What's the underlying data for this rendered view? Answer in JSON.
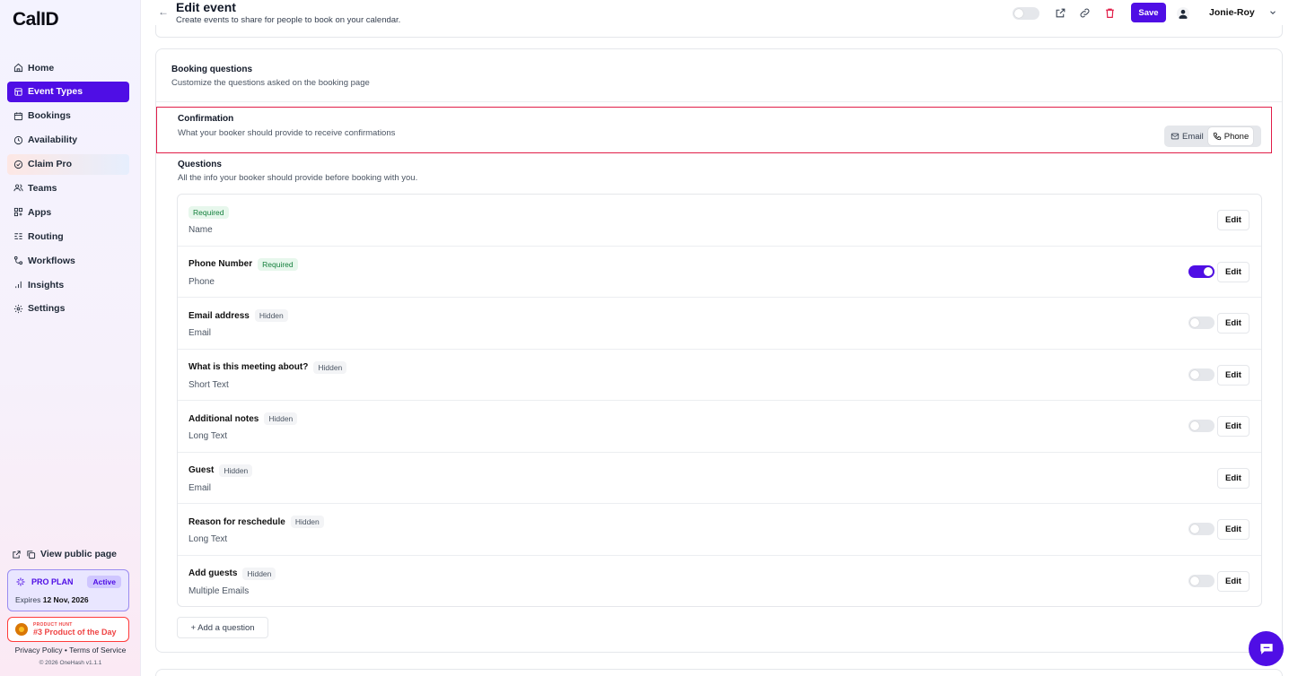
{
  "brand": {
    "logo": "CalID",
    "accent": "#4f0ee5"
  },
  "sidebar": {
    "items": [
      {
        "label": "Home",
        "icon": "home-icon"
      },
      {
        "label": "Event Types",
        "icon": "link-icon",
        "active": true
      },
      {
        "label": "Bookings",
        "icon": "calendar-icon"
      },
      {
        "label": "Availability",
        "icon": "clock-icon"
      },
      {
        "label": "Claim Pro",
        "icon": "badge-icon"
      },
      {
        "label": "Teams",
        "icon": "users-icon"
      },
      {
        "label": "Apps",
        "icon": "grid-icon"
      },
      {
        "label": "Routing",
        "icon": "routing-icon"
      },
      {
        "label": "Workflows",
        "icon": "workflow-icon"
      },
      {
        "label": "Insights",
        "icon": "bar-chart-icon"
      },
      {
        "label": "Settings",
        "icon": "gear-icon"
      }
    ],
    "public_page": "View public page",
    "plan": {
      "name": "PRO PLAN",
      "status": "Active",
      "expires_label": "Expires",
      "expires_date": "12 Nov, 2026"
    },
    "product_hunt": {
      "small": "PRODUCT HUNT",
      "main": "#3 Product of the Day"
    },
    "legal": "Privacy Policy • Terms of Service",
    "copyright": "© 2026 OneHash v1.1.1"
  },
  "header": {
    "title": "Edit event",
    "subtitle": "Create events to share for people to book on your calendar.",
    "save_label": "Save",
    "user": "Jonie-Roy"
  },
  "booking": {
    "title": "Booking questions",
    "subtitle": "Customize the questions asked on the booking page",
    "confirmation": {
      "title": "Confirmation",
      "subtitle": "What your booker should provide to receive confirmations",
      "options": [
        "Email",
        "Phone"
      ],
      "selected": "Phone"
    },
    "questions_title": "Questions",
    "questions_subtitle": "All the info your booker should provide before booking with you.",
    "questions": [
      {
        "label": "",
        "badge": "Required",
        "type": "Name",
        "toggle": null
      },
      {
        "label": "Phone Number",
        "badge": "Required",
        "type": "Phone",
        "toggle": true
      },
      {
        "label": "Email address",
        "badge": "Hidden",
        "type": "Email",
        "toggle": false
      },
      {
        "label": "What is this meeting about?",
        "badge": "Hidden",
        "type": "Short Text",
        "toggle": false
      },
      {
        "label": "Additional notes",
        "badge": "Hidden",
        "type": "Long Text",
        "toggle": false
      },
      {
        "label": "Guest",
        "badge": "Hidden",
        "type": "Email",
        "toggle": null
      },
      {
        "label": "Reason for reschedule",
        "badge": "Hidden",
        "type": "Long Text",
        "toggle": false
      },
      {
        "label": "Add guests",
        "badge": "Hidden",
        "type": "Multiple Emails",
        "toggle": false
      }
    ],
    "edit_label": "Edit",
    "add_question": "+ Add a question"
  }
}
